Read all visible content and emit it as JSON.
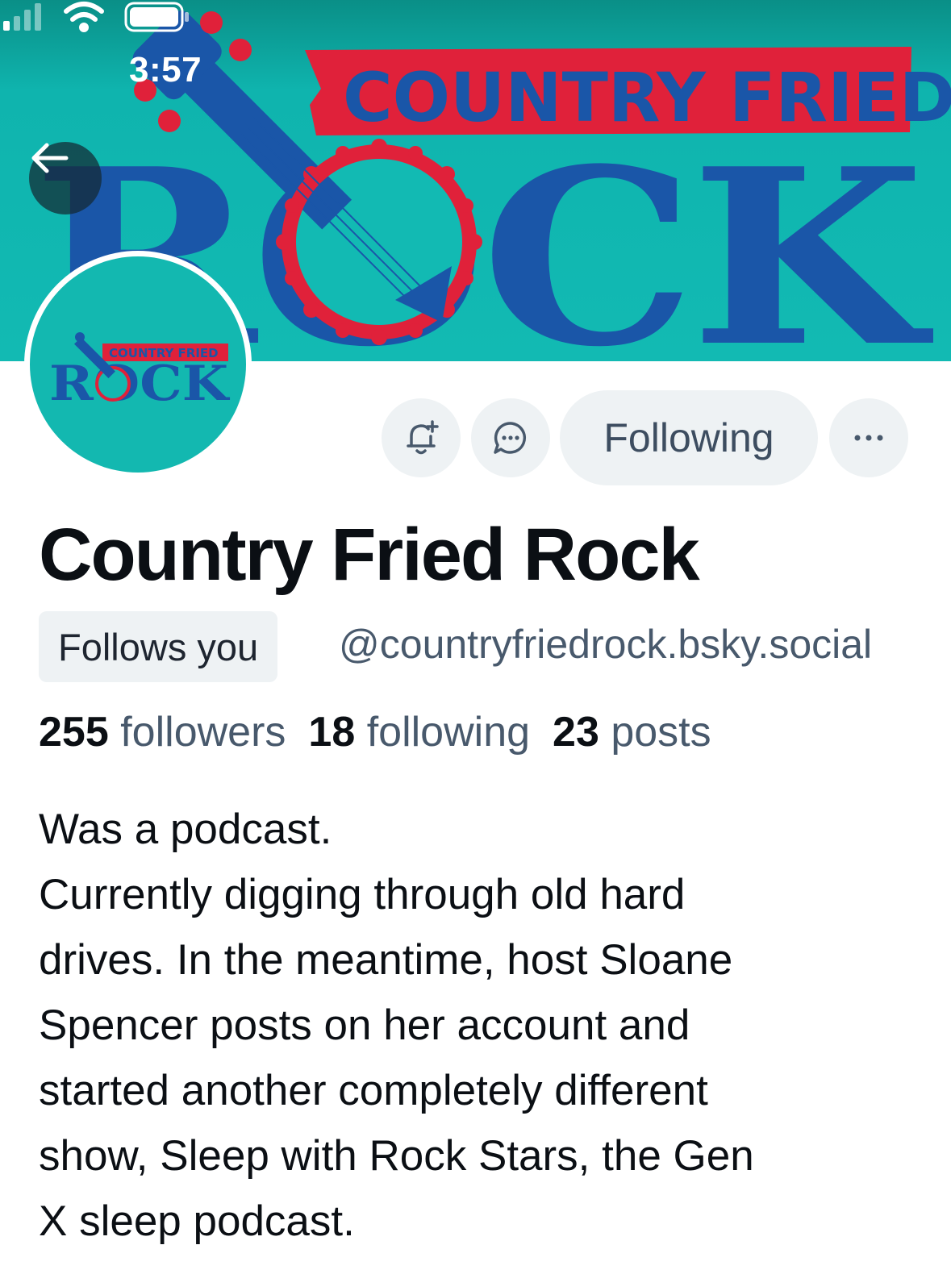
{
  "status_bar": {
    "time": "3:57",
    "icons": [
      "cellular-icon",
      "wifi-icon",
      "battery-icon"
    ]
  },
  "banner": {
    "line1": "COUNTRY FRIED",
    "line2": "ROCK",
    "colors": {
      "teal": "#12bab3",
      "blue": "#1a56a8",
      "red": "#e0213a"
    }
  },
  "avatar": {
    "line1": "COUNTRY FRIED",
    "line2": "ROCK"
  },
  "actions": {
    "following_label": "Following",
    "icons": [
      "bell-plus-icon",
      "chat-bubble-icon",
      "more-icon"
    ]
  },
  "profile": {
    "display_name": "Country Fried Rock",
    "follows_you": "Follows you",
    "handle": "@countryfriedrock.bsky.social",
    "stats": {
      "followers_count": "255",
      "followers_label": "followers",
      "following_count": "18",
      "following_label": "following",
      "posts_count": "23",
      "posts_label": "posts"
    },
    "bio_lines": [
      "Was a podcast.",
      "Currently digging through old hard",
      "drives. In the meantime, host Sloane",
      "Spencer posts on her account and",
      "started another completely different",
      "show, Sleep with Rock Stars, the Gen",
      "X sleep podcast."
    ]
  }
}
